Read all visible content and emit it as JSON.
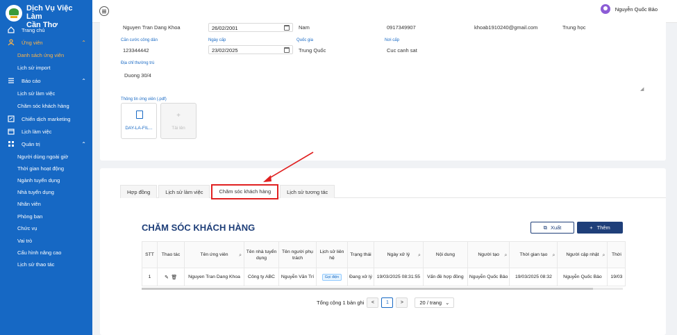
{
  "app": {
    "title_line1": "Dịch Vụ Việc Làm",
    "title_line2": "Cần Thơ"
  },
  "sidebar": {
    "items": [
      {
        "label": "Trang chủ",
        "icon": "home-icon"
      },
      {
        "label": "Ứng viên",
        "icon": "user-icon",
        "active": true
      },
      {
        "label": "Danh sách ứng viên",
        "sub": true,
        "active": true
      },
      {
        "label": "Lịch sử import",
        "sub": true
      },
      {
        "label": "Báo cáo",
        "icon": "list-icon"
      },
      {
        "label": "Lịch sử làm việc",
        "sub": true
      },
      {
        "label": "Chăm sóc khách hàng",
        "sub": true
      },
      {
        "label": "Chiến dịch marketing",
        "icon": "campaign-icon"
      },
      {
        "label": "Lịch làm việc",
        "icon": "calendar-icon"
      },
      {
        "label": "Quản trị",
        "icon": "admin-icon"
      },
      {
        "label": "Người dùng ngoài giờ",
        "sub": true
      },
      {
        "label": "Thời gian hoạt động",
        "sub": true
      },
      {
        "label": "Ngành tuyển dụng",
        "sub": true
      },
      {
        "label": "Nhà tuyển dụng",
        "sub": true
      },
      {
        "label": "Nhân viên",
        "sub": true
      },
      {
        "label": "Phòng ban",
        "sub": true
      },
      {
        "label": "Chức vụ",
        "sub": true
      },
      {
        "label": "Vai trò",
        "sub": true
      },
      {
        "label": "Cấu hình nâng cao",
        "sub": true
      },
      {
        "label": "Lịch sử thao tác",
        "sub": true
      }
    ]
  },
  "header": {
    "user_name": "Nguyễn Quốc Bảo"
  },
  "candidate": {
    "name": "Nguyen Tran Dang Khoa",
    "dob": "26/02/2001",
    "gender": "Nam",
    "phone": "0917349907",
    "email": "khoab1910240@gmail.com",
    "education": "Trung học",
    "id_label": "Căn cước công dân",
    "id_value": "123344442",
    "issue_date_label": "Ngày cấp",
    "issue_date": "23/02/2025",
    "country_label": "Quốc gia",
    "country": "Trung Quốc",
    "issue_place_label": "Nơi cấp",
    "issue_place": "Cuc canh sat",
    "address_label": "Địa chỉ thường trú",
    "address": "Duong 30/4",
    "file_label": "Thông tin ứng viên (.pdf)",
    "file_name": "DAY-LA-FIL...",
    "upload_label": "Tải lên"
  },
  "tabs": [
    {
      "label": "Hợp đồng"
    },
    {
      "label": "Lịch sử làm việc"
    },
    {
      "label": "Chăm sóc khách hàng",
      "selected": true
    },
    {
      "label": "Lịch sử tương tác"
    }
  ],
  "section": {
    "title": "CHĂM SÓC KHÁCH HÀNG",
    "export_label": "Xuất",
    "add_label": "Thêm"
  },
  "table": {
    "headers": [
      "STT",
      "Thao tác",
      "Tên ứng viên",
      "Tên nhà tuyển dụng",
      "Tên người phụ trách",
      "Lịch sử liên hệ",
      "Trạng thái",
      "Ngày xử lý",
      "Nội dung",
      "Người tạo",
      "Thời gian tạo",
      "Người cập nhật",
      "Thời"
    ],
    "rows": [
      {
        "stt": "1",
        "candidate": "Nguyen Tran Dang Khoa",
        "employer": "Công ty ABC",
        "owner": "Nguyễn Văn Trí",
        "contact": "Gọi điện",
        "status": "Đang xử lý",
        "date": "19/03/2025 08:31:55",
        "content": "Vấn đề hợp đồng",
        "creator": "Nguyễn Quốc Bảo",
        "created": "19/03/2025 08:32",
        "updater": "Nguyễn Quốc Bảo",
        "more": "19/03"
      }
    ]
  },
  "pagination": {
    "total": "Tổng cộng 1 bản ghi",
    "prev": "<",
    "current": "1",
    "next": ">",
    "page_size": "20 / trang"
  },
  "colors": {
    "sidebar": "#1668c4",
    "accent": "#1f3f79",
    "highlight": "#e02020",
    "active_nav": "#ffb547"
  }
}
